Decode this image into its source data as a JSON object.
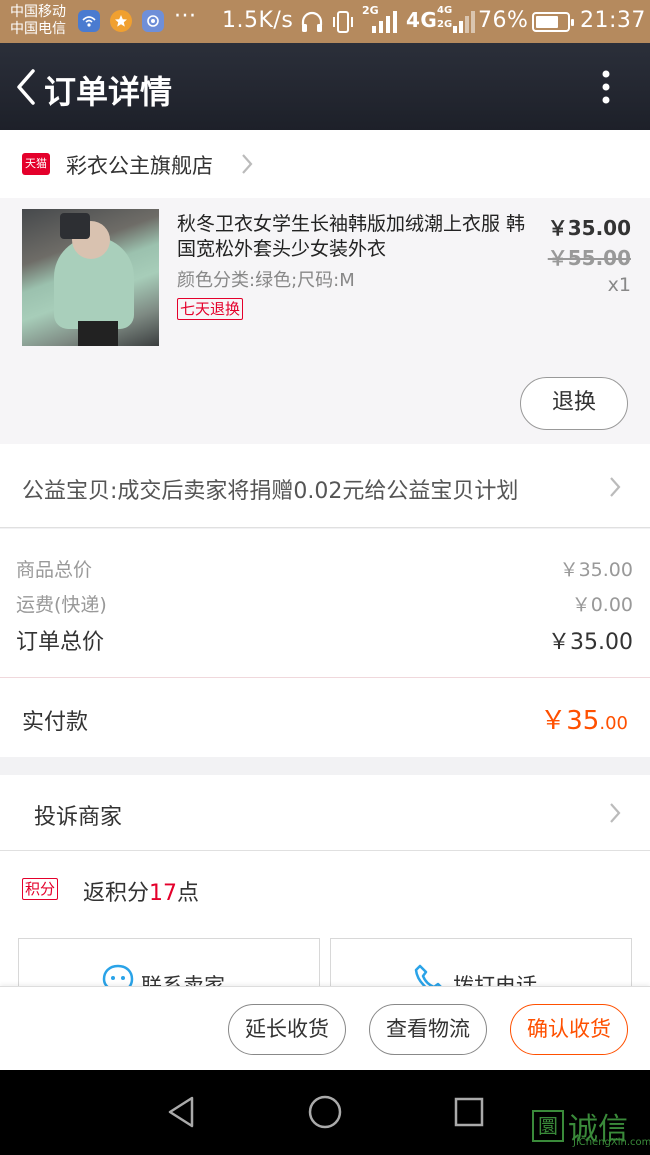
{
  "status_bar": {
    "carrier_1": "中国移动",
    "carrier_2": "中国电信",
    "dots": "···",
    "speed": "1.5K/s",
    "net_2g": "2G",
    "net_4g": "4G",
    "net_4g_small": "4G",
    "net_2g_small": "2G",
    "battery_percent": "76%",
    "battery_level": 0.76,
    "time": "21:37"
  },
  "nav": {
    "title": "订单详情"
  },
  "store": {
    "logo_text": "天猫",
    "name": "彩衣公主旗舰店"
  },
  "product": {
    "title": "秋冬卫衣女学生长袖韩版加绒潮上衣服 韩国宽松外套头少女装外衣",
    "spec": "颜色分类:绿色;尺码:M",
    "return_badge": "七天退换",
    "price_now": "￥35.00",
    "price_original": "￥55.00",
    "quantity": "x1",
    "exchange_button": "退换"
  },
  "charity": {
    "text": "公益宝贝:成交后卖家将捐赠0.02元给公益宝贝计划"
  },
  "summary": {
    "goods_label": "商品总价",
    "goods_value": "￥35.00",
    "shipping_label": "运费(快递)",
    "shipping_value": "￥0.00",
    "total_label": "订单总价",
    "total_value": "￥35.00"
  },
  "paid": {
    "label": "实付款",
    "value_int": "￥35",
    "value_dec": ".00"
  },
  "complain": {
    "label": "投诉商家"
  },
  "points": {
    "badge": "积分",
    "prefix": "返积分",
    "number": "17",
    "suffix": "点"
  },
  "contact": {
    "seller_label": "联系卖家",
    "phone_label": "拨打电话"
  },
  "actions": {
    "extend": "延长收货",
    "logistics": "查看物流",
    "confirm": "确认收货"
  },
  "watermark": {
    "mark": "圜",
    "name": "诚信",
    "site": "JiChengXin.com"
  },
  "colors": {
    "status_bar": "#b58a5e",
    "nav_bar": "#23262f",
    "tmall_red": "#e4002b",
    "accent_orange": "#ff5000"
  }
}
